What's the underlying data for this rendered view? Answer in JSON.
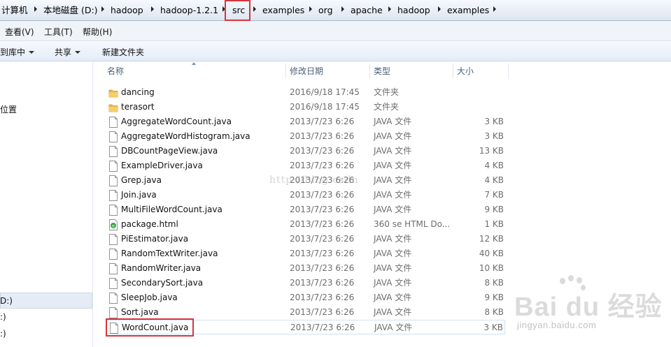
{
  "breadcrumb": {
    "items": [
      "计算机",
      "本地磁盘 (D:)",
      "hadoop",
      "hadoop-1.2.1",
      "src",
      "examples",
      "org",
      "apache",
      "hadoop",
      "examples"
    ]
  },
  "menu": {
    "items": [
      "查看(V)",
      "工具(T)",
      "帮助(H)"
    ]
  },
  "toolbar": {
    "include_library": "到库中",
    "share": "共享",
    "new_folder": "新建文件夹"
  },
  "nav": {
    "locations_label": "位置",
    "drive_d": "D:)",
    "drive_e": ":)",
    "drive_f": ":)"
  },
  "columns": {
    "name": "名称",
    "date": "修改日期",
    "type": "类型",
    "size": "大小"
  },
  "files": [
    {
      "name": "dancing",
      "date": "2016/9/18 17:45",
      "type": "文件夹",
      "size": "",
      "icon": "folder-icon"
    },
    {
      "name": "terasort",
      "date": "2016/9/18 17:45",
      "type": "文件夹",
      "size": "",
      "icon": "folder-icon"
    },
    {
      "name": "AggregateWordCount.java",
      "date": "2013/7/23 6:26",
      "type": "JAVA 文件",
      "size": "3 KB",
      "icon": "file-icon"
    },
    {
      "name": "AggregateWordHistogram.java",
      "date": "2013/7/23 6:26",
      "type": "JAVA 文件",
      "size": "3 KB",
      "icon": "file-icon"
    },
    {
      "name": "DBCountPageView.java",
      "date": "2013/7/23 6:26",
      "type": "JAVA 文件",
      "size": "13 KB",
      "icon": "file-icon"
    },
    {
      "name": "ExampleDriver.java",
      "date": "2013/7/23 6:26",
      "type": "JAVA 文件",
      "size": "4 KB",
      "icon": "file-icon"
    },
    {
      "name": "Grep.java",
      "date": "2013/7/23 6:26",
      "type": "JAVA 文件",
      "size": "4 KB",
      "icon": "file-icon"
    },
    {
      "name": "Join.java",
      "date": "2013/7/23 6:26",
      "type": "JAVA 文件",
      "size": "7 KB",
      "icon": "file-icon"
    },
    {
      "name": "MultiFileWordCount.java",
      "date": "2013/7/23 6:26",
      "type": "JAVA 文件",
      "size": "9 KB",
      "icon": "file-icon"
    },
    {
      "name": "package.html",
      "date": "2013/7/23 6:26",
      "type": "360 se HTML Do...",
      "size": "1 KB",
      "icon": "html-file-icon"
    },
    {
      "name": "PiEstimator.java",
      "date": "2013/7/23 6:26",
      "type": "JAVA 文件",
      "size": "12 KB",
      "icon": "file-icon"
    },
    {
      "name": "RandomTextWriter.java",
      "date": "2013/7/23 6:26",
      "type": "JAVA 文件",
      "size": "40 KB",
      "icon": "file-icon"
    },
    {
      "name": "RandomWriter.java",
      "date": "2013/7/23 6:26",
      "type": "JAVA 文件",
      "size": "10 KB",
      "icon": "file-icon"
    },
    {
      "name": "SecondarySort.java",
      "date": "2013/7/23 6:26",
      "type": "JAVA 文件",
      "size": "8 KB",
      "icon": "file-icon"
    },
    {
      "name": "SleepJob.java",
      "date": "2013/7/23 6:26",
      "type": "JAVA 文件",
      "size": "9 KB",
      "icon": "file-icon"
    },
    {
      "name": "Sort.java",
      "date": "2013/7/23 6:26",
      "type": "JAVA 文件",
      "size": "8 KB",
      "icon": "file-icon"
    },
    {
      "name": "WordCount.java",
      "date": "2013/7/23 6:26",
      "type": "JAVA 文件",
      "size": "3 KB",
      "icon": "file-icon"
    }
  ],
  "watermark": {
    "center": "http://blog.csdn",
    "logo": "Bai du 经验",
    "url": "jingyan.baidu.com"
  },
  "colors": {
    "highlight": "#d9343c",
    "folder": "#e9b949",
    "header_text": "#4c607a"
  }
}
